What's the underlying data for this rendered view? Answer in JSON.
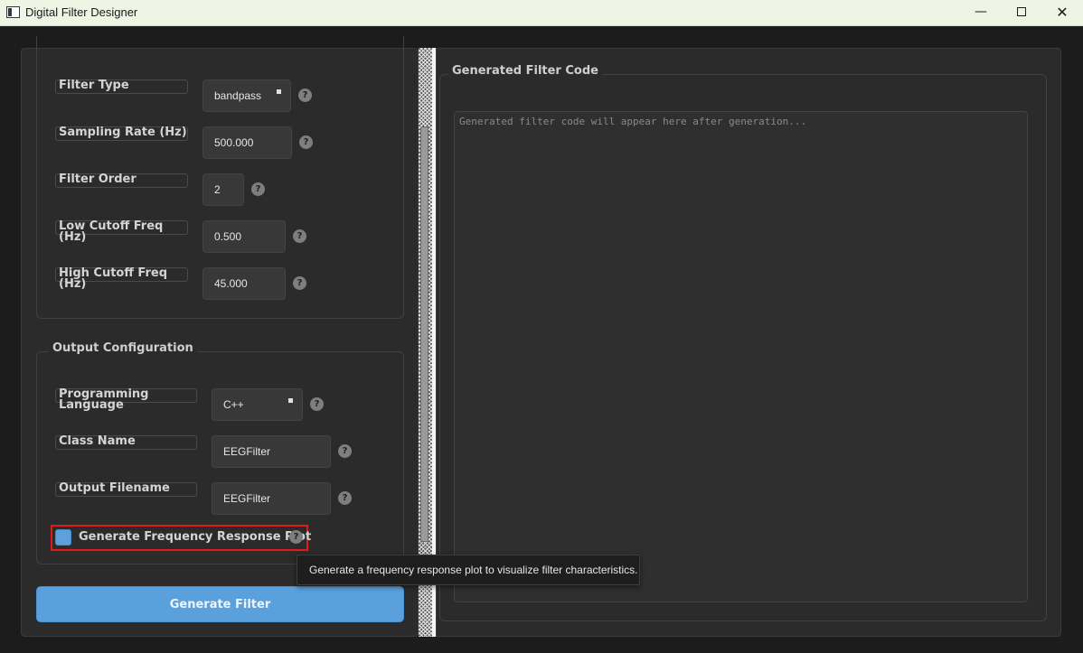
{
  "window": {
    "title": "Digital Filter Designer",
    "minimize": "—",
    "close": "✕"
  },
  "filter_params": {
    "filter_type_label": "Filter Type",
    "filter_type_value": "bandpass",
    "sampling_rate_label": "Sampling Rate (Hz)",
    "sampling_rate_value": "500.000",
    "filter_order_label": "Filter Order",
    "filter_order_value": "2",
    "low_cutoff_label": "Low Cutoff Freq (Hz)",
    "low_cutoff_value": "0.500",
    "high_cutoff_label": "High Cutoff Freq (Hz)",
    "high_cutoff_value": "45.000"
  },
  "output_config": {
    "title": "Output Configuration",
    "language_label": "Programming Language",
    "language_value": "C++",
    "class_name_label": "Class Name",
    "class_name_value": "EEGFilter",
    "filename_label": "Output Filename",
    "filename_value": "EEGFilter",
    "plot_checkbox_label": "Generate Frequency Response Plot",
    "plot_checkbox_checked": true
  },
  "help_glyph": "?",
  "generate_button": "Generate Filter",
  "code_panel": {
    "title": "Generated Filter Code",
    "placeholder": "Generated filter code will appear here after generation..."
  },
  "tooltip": "Generate a frequency response plot to visualize filter characteristics.",
  "colors": {
    "accent": "#5aa0dc",
    "highlight": "#e01b1b",
    "panel_bg": "#2b2b2b"
  }
}
